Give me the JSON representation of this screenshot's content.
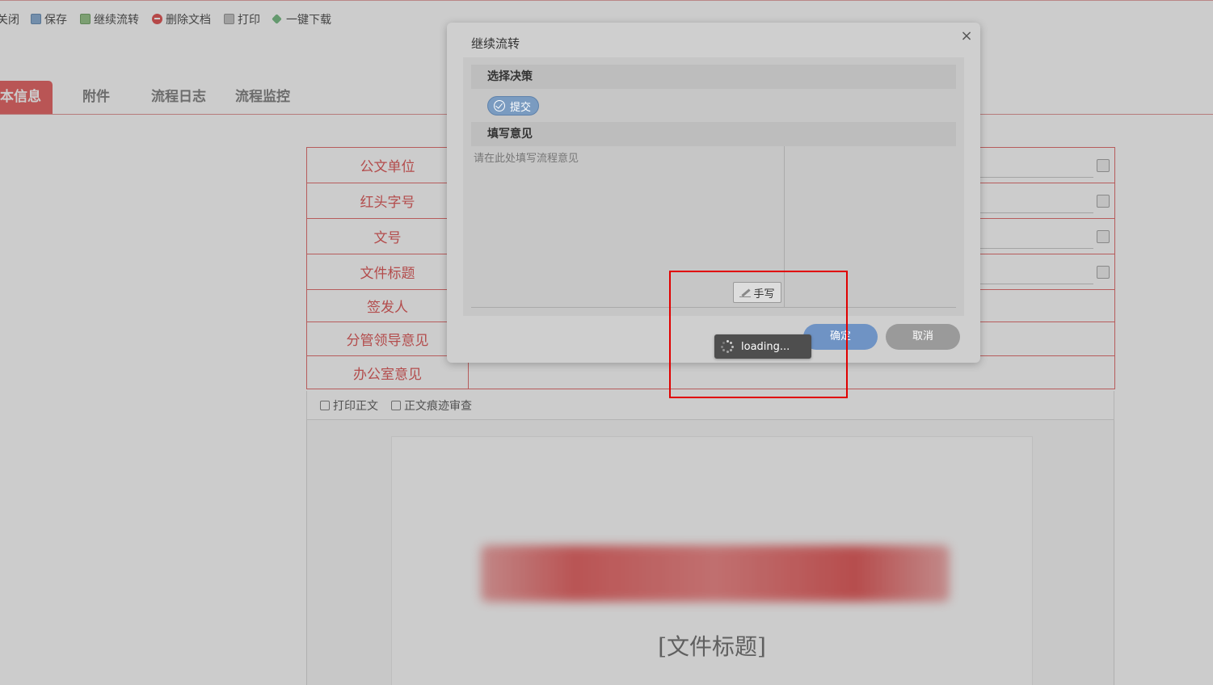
{
  "toolbar": {
    "items": [
      {
        "label": "关闭",
        "icon": "close-icon"
      },
      {
        "label": "保存",
        "icon": "save-icon"
      },
      {
        "label": "继续流转",
        "icon": "flow-icon"
      },
      {
        "label": "删除文档",
        "icon": "delete-icon"
      },
      {
        "label": "打印",
        "icon": "print-icon"
      },
      {
        "label": "一键下载",
        "icon": "download-icon"
      }
    ]
  },
  "tabs": [
    {
      "label": "本信息",
      "active": true
    },
    {
      "label": "附件"
    },
    {
      "label": "流程日志"
    },
    {
      "label": "流程监控"
    }
  ],
  "form": {
    "rows": [
      {
        "label": "公文单位"
      },
      {
        "label": "红头字号"
      },
      {
        "label": "文号"
      },
      {
        "label": "文件标题"
      },
      {
        "label": "签发人"
      },
      {
        "label": "分管领导意见"
      },
      {
        "label": "办公室意见"
      }
    ]
  },
  "doc_toolbar": {
    "print_label": "打印正文",
    "review_label": "正文痕迹审查"
  },
  "document": {
    "title": "[文件标题]"
  },
  "dialog": {
    "title": "继续流转",
    "close": "×",
    "decision_header": "选择决策",
    "decision_option": "提交",
    "opinion_header": "填写意见",
    "opinion_placeholder": "请在此处填写流程意见",
    "handwrite_label": "手写",
    "ok_label": "确定",
    "cancel_label": "取消"
  },
  "loading": {
    "text": "loading..."
  },
  "colors": {
    "accent_red": "#e86b6b",
    "form_border": "#e57373",
    "ok_button": "#6f93c4",
    "cancel_button": "#9a9a9a",
    "highlight": "#e00000"
  }
}
